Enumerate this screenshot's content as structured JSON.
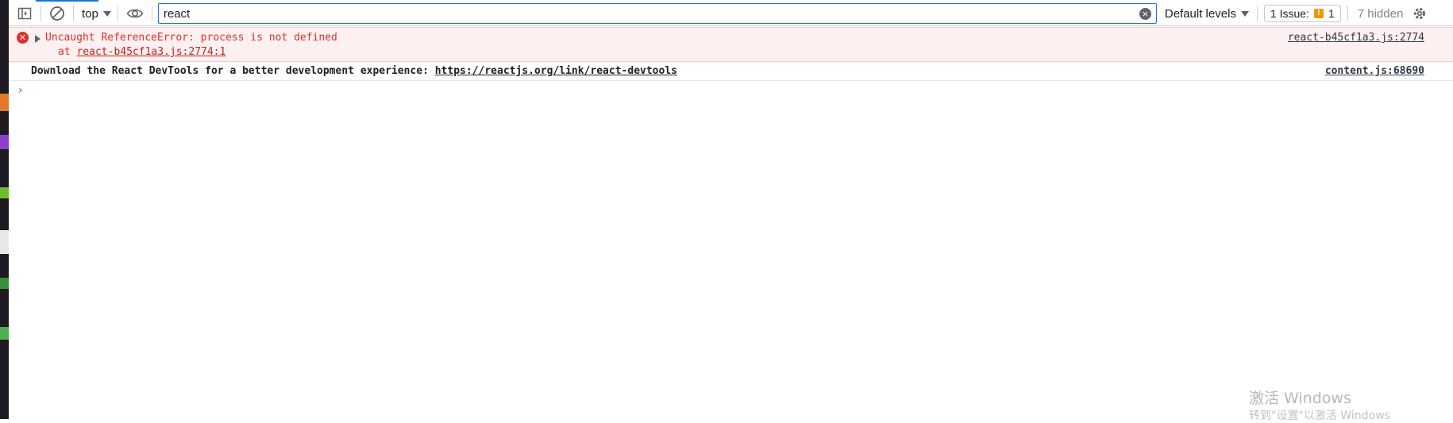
{
  "toolbar": {
    "context": "top",
    "filter_value": "react",
    "levels_label": "Default levels",
    "issues_label": "1 Issue:",
    "issues_count": "1",
    "hidden_label": "7 hidden",
    "icons": [
      "sidebar-toggle-icon",
      "clear-console-icon",
      "eye-icon",
      "clear-filter-icon",
      "gear-icon"
    ]
  },
  "console": {
    "error": {
      "message": "Uncaught ReferenceError: process is not defined",
      "stack_prefix": "at ",
      "stack_link": "react-b45cf1a3.js:2774:1",
      "source": "react-b45cf1a3.js:2774"
    },
    "log": {
      "text": "Download the React DevTools for a better development experience: ",
      "link": "https://reactjs.org/link/react-devtools",
      "source": "content.js:68690"
    },
    "prompt_symbol": "›"
  },
  "watermark": {
    "title": "激活 Windows",
    "subtitle": "转到\"设置\"以激活 Windows"
  },
  "colors": {
    "error_text": "#e02f2f",
    "error_bg": "#fdf0f0",
    "accent": "#1a73e8",
    "issue_flag": "#f29900"
  }
}
